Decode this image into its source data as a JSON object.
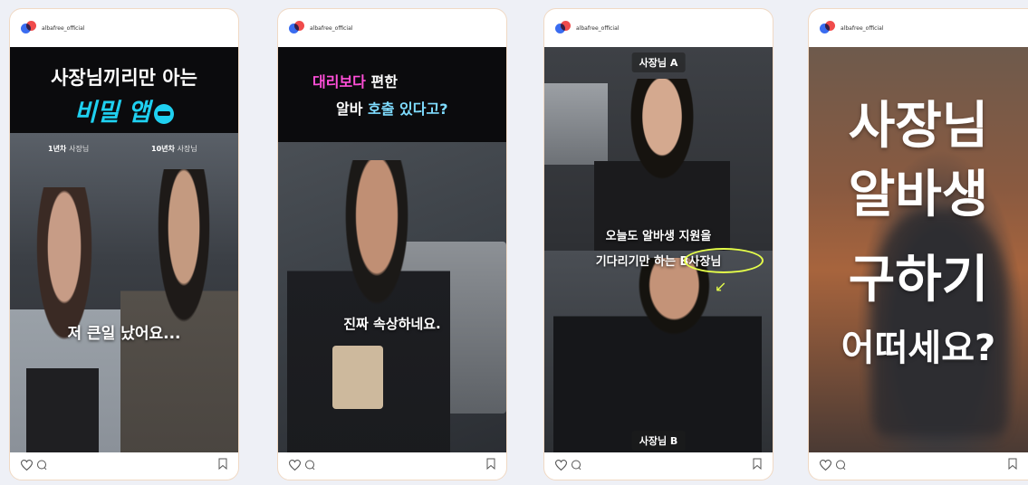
{
  "account": {
    "username": "albafree_official"
  },
  "cards": [
    {
      "banner_line1": "사장님끼리만 아는",
      "banner_line2": "비밀 앱",
      "tag_left_bold": "1년차",
      "tag_left_light": "사장님",
      "tag_right_bold": "10년차",
      "tag_right_light": "사장님",
      "subtitle": "저 큰일 났어요..."
    },
    {
      "line1_colored": "대리보다",
      "line1_white": "편한",
      "line2_white": "알바",
      "line2_colored": "호출 있다고?",
      "subtitle": "진짜 속상하네요."
    },
    {
      "label_top": "사장님 A",
      "subtitle_line1": "오늘도 알바생 지원을",
      "subtitle_line2": "기다리기만 하는 B사장님",
      "label_bottom": "사장님 B"
    },
    {
      "line1": "사장님",
      "line2": "알바생",
      "line3": "구하기",
      "line4": "어떠세요?"
    }
  ],
  "colors": {
    "accent_cyan": "#1fd0f0",
    "accent_pink": "#ff4fd8",
    "accent_lightblue": "#7fdcff",
    "highlight_yellow": "#e6ff4a"
  },
  "icons": [
    "heart-icon",
    "comment-icon",
    "bookmark-icon",
    "profile-avatar"
  ]
}
